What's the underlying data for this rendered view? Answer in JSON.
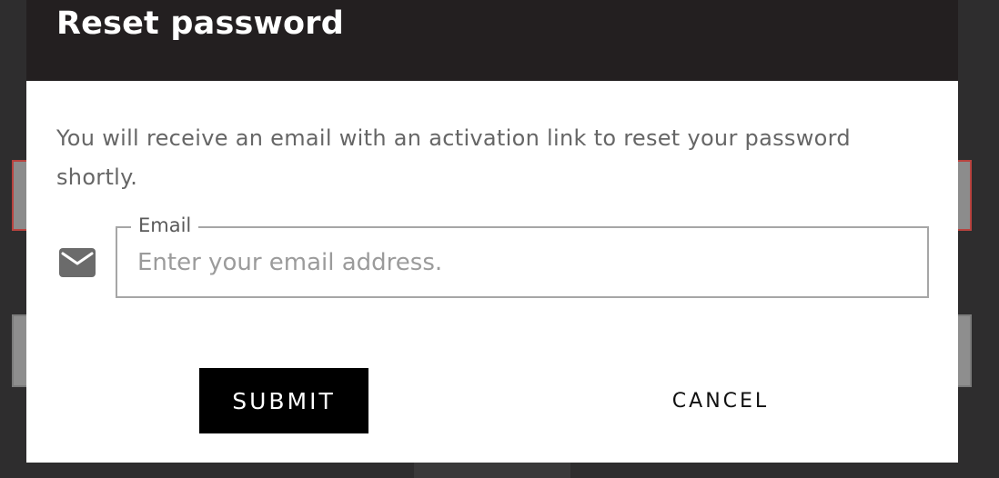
{
  "dialog": {
    "title": "Reset password",
    "description": "You will receive an email with an activation link to reset your password shortly.",
    "email": {
      "label": "Email",
      "placeholder": "Enter your email address.",
      "value": "",
      "icon": "mail-icon"
    },
    "actions": {
      "submit_label": "SUBMIT",
      "cancel_label": "CANCEL"
    }
  },
  "colors": {
    "header_bg": "#231f20",
    "primary_button_bg": "#000000",
    "error_border": "#b9433f"
  }
}
